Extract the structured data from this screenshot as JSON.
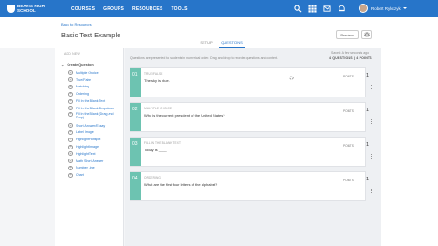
{
  "app": {
    "logo_text": "BEAVIS HIGH SCHOOL",
    "nav": [
      "COURSES",
      "GROUPS",
      "RESOURCES",
      "TOOLS"
    ],
    "user_name": "Robert Rybczyk"
  },
  "header": {
    "breadcrumb": "Back to Resources",
    "title": "Basic Test Example",
    "preview_label": "Preview",
    "tabs": [
      {
        "label": "SETUP",
        "active": false
      },
      {
        "label": "QUESTIONS",
        "active": true
      }
    ]
  },
  "sidebar": {
    "add_new": "ADD NEW",
    "create_label": "Create Question",
    "items": [
      "Multiple Choice",
      "True/False",
      "Matching",
      "Ordering",
      "Fill In the Blank Text",
      "Fill In the Blank Dropdown",
      "Fill In the Blank (Drag and Drop)",
      "Short Answer/Essay",
      "Label Image",
      "Highlight Hotspot",
      "Highlight Image",
      "Highlight Text",
      "Math Short Answer",
      "Number Line",
      "Chart"
    ]
  },
  "main": {
    "info": "Questions are presented to students in numerical order. Drag and drop to reorder questions and content.",
    "saved": "Saved: A few seconds ago",
    "counts": "4 QUESTIONS  |  4 POINTS",
    "points_label": "POINTS",
    "questions": [
      {
        "num": "01",
        "type": "TRUE/FALSE",
        "text": "The sky is blue.",
        "points": "1"
      },
      {
        "num": "02",
        "type": "MULTIPLE CHOICE",
        "text": "Who is the current president of the United States?",
        "points": "1"
      },
      {
        "num": "03",
        "type": "FILL IN THE BLANK TEXT",
        "text": "Today is ____",
        "points": "1"
      },
      {
        "num": "04",
        "type": "ORDERING",
        "text": "What are the first four letters of the alphabet?",
        "points": "1"
      }
    ]
  },
  "colors": {
    "brand": "#2775c9",
    "accent": "#6dc3b1"
  }
}
